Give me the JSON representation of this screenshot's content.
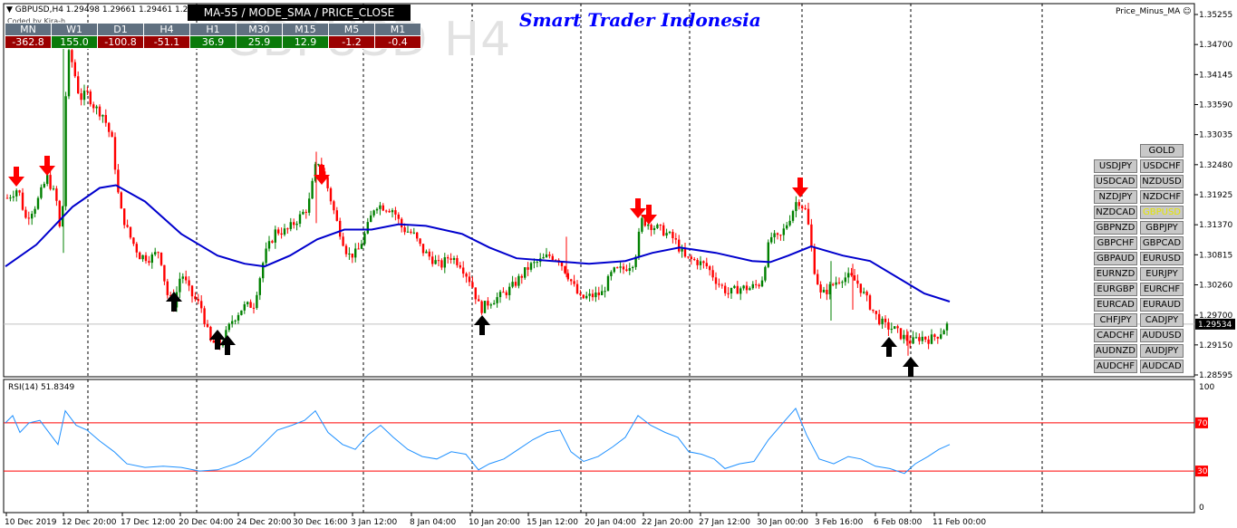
{
  "chart_header": {
    "symbol_info": "▼ GBPUSD,H4  1.29498 1.29661 1.29461 1.29",
    "coded_by": "Coded by Kira-h",
    "watermark": "GBPUSD H4",
    "ma_label": "MA-55 / MODE_SMA / PRICE_CLOSE",
    "brand": "Smart Trader Indonesia",
    "indicator_name": "Price_Minus_MA ☺"
  },
  "timeframe_table": {
    "headers": [
      "MN",
      "W1",
      "D1",
      "H4",
      "H1",
      "M30",
      "M15",
      "M5",
      "M1"
    ],
    "values": [
      "-362.8",
      "155.0",
      "-100.8",
      "-51.1",
      "36.9",
      "25.9",
      "12.9",
      "-1.2",
      "-0.4"
    ],
    "signs": [
      "neg",
      "pos",
      "neg",
      "neg",
      "pos",
      "pos",
      "pos",
      "neg",
      "neg"
    ]
  },
  "pair_buttons": {
    "gold": "GOLD",
    "left": [
      "USDJPY",
      "USDCAD",
      "NZDJPY",
      "NZDCAD",
      "GBPNZD",
      "GBPCHF",
      "GBPAUD",
      "EURNZD",
      "EURGBP",
      "EURCAD",
      "CHFJPY",
      "CADCHF",
      "AUDNZD",
      "AUDCHF"
    ],
    "right": [
      "USDCHF",
      "NZDUSD",
      "NZDCHF",
      "GBPUSD",
      "GBPJPY",
      "GBPCAD",
      "EURUSD",
      "EURJPY",
      "EURCHF",
      "EURAUD",
      "CADJPY",
      "AUDUSD",
      "AUDJPY",
      "AUDCAD"
    ],
    "active": "GBPUSD"
  },
  "price_axis": {
    "ticks": [
      "1.35255",
      "1.34700",
      "1.34145",
      "1.33590",
      "1.33035",
      "1.32480",
      "1.31925",
      "1.31370",
      "1.30815",
      "1.30260",
      "1.29700",
      "1.29150",
      "1.28595"
    ],
    "current_price": "1.29534"
  },
  "time_axis": {
    "labels": [
      "10 Dec 2019",
      "12 Dec 20:00",
      "17 Dec 12:00",
      "20 Dec 04:00",
      "24 Dec 20:00",
      "30 Dec 16:00",
      "3 Jan 12:00",
      "8 Jan 04:00",
      "10 Jan 20:00",
      "15 Jan 12:00",
      "20 Jan 04:00",
      "22 Jan 20:00",
      "27 Jan 12:00",
      "30 Jan 00:00",
      "3 Feb 16:00",
      "6 Feb 08:00",
      "11 Feb 00:00"
    ]
  },
  "rsi": {
    "label": "RSI(14) 51.8349",
    "levels": [
      "100",
      "70",
      "30",
      "0"
    ]
  },
  "colors": {
    "bull_candle": "#008000",
    "bear_candle": "#ff0000",
    "ma_line": "#0000cd",
    "rsi_line": "#1e90ff",
    "rsi_levels": "#ff0000",
    "sell_arrow": "#ff0000",
    "buy_arrow": "#000000",
    "brand": "#0000ff"
  },
  "chart_data": {
    "type": "candlestick",
    "symbol": "GBPUSD",
    "timeframe": "H4",
    "ylim": [
      1.28595,
      1.35255
    ],
    "ma_period": 55,
    "rsi_value": 51.8349,
    "rsi_period": 14
  }
}
